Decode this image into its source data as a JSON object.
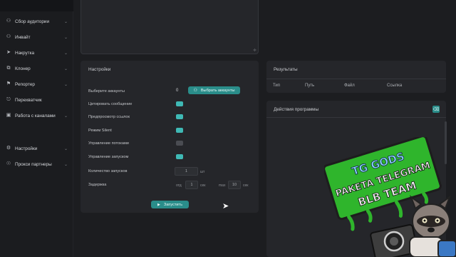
{
  "sidebar": {
    "items": [
      {
        "icon": "users-icon",
        "label": "Сбор аудитории",
        "chevron": true
      },
      {
        "icon": "user-plus-icon",
        "label": "Инвайт",
        "chevron": true
      },
      {
        "icon": "send-icon",
        "label": "Накрутка",
        "chevron": true
      },
      {
        "icon": "clone-icon",
        "label": "Клонер",
        "chevron": true
      },
      {
        "icon": "flag-icon",
        "label": "Репортер",
        "chevron": true
      },
      {
        "icon": "intercept-icon",
        "label": "Перехватчик",
        "chevron": false
      },
      {
        "icon": "folder-icon",
        "label": "Работа с каналами",
        "chevron": true
      },
      {
        "icon": "gear-icon",
        "label": "Настройки",
        "chevron": true
      },
      {
        "icon": "proxy-icon",
        "label": "Прокси партнеры",
        "chevron": true
      }
    ]
  },
  "settings": {
    "title": "Настройки",
    "select_accounts_label": "Выберите аккаунты",
    "accounts_count": "0",
    "select_accounts_button": "Выбрать аккаунты",
    "toggles": [
      {
        "label": "Цитировать сообщение",
        "on": true
      },
      {
        "label": "Предпросмотр ссылок",
        "on": true
      },
      {
        "label": "Режим Silent",
        "on": true
      },
      {
        "label": "Управление потоками",
        "on": false
      },
      {
        "label": "Управление запуском",
        "on": true
      }
    ],
    "launch_count_label": "Количество запусков",
    "launch_count_value": "1",
    "launch_count_unit": "шт",
    "delay_label": "Задержка",
    "delay_min_prefix": "отд",
    "delay_min_value": "1",
    "delay_min_unit": "сек",
    "delay_max_prefix": "max",
    "delay_max_value": "10",
    "delay_max_unit": "сек",
    "start_button": "Запустить"
  },
  "results": {
    "title": "Результаты",
    "columns": [
      "Тип",
      "Путь",
      "Файл",
      "Ссылка"
    ]
  },
  "actions": {
    "title": "Действия программы"
  },
  "sticker": {
    "line1": "TG GODS",
    "line2": "PAKETA TELEGRAM",
    "line3": "BLB TEAM"
  }
}
